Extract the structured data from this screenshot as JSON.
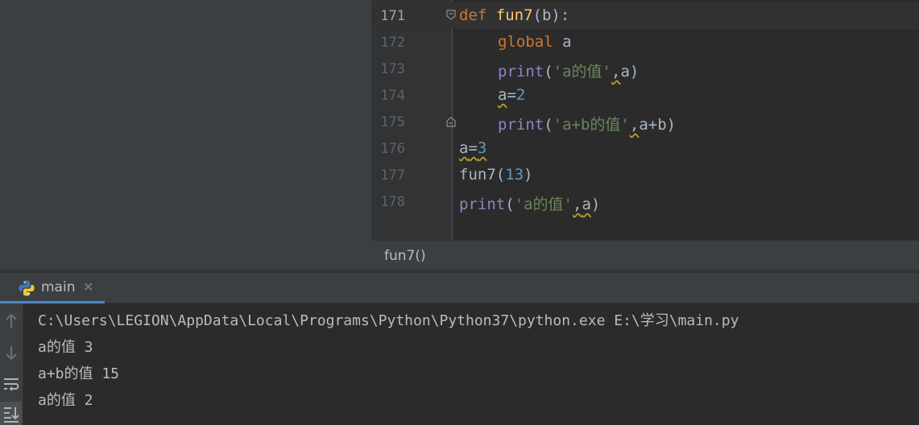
{
  "editor": {
    "lines": [
      {
        "number": "171"
      },
      {
        "number": "172"
      },
      {
        "number": "173"
      },
      {
        "number": "174"
      },
      {
        "number": "175"
      },
      {
        "number": "176"
      },
      {
        "number": "177"
      },
      {
        "number": "178"
      }
    ],
    "code": {
      "l171": {
        "kw": "def",
        "name": "fun7",
        "rest": "(b):"
      },
      "l172": {
        "kw": "global",
        "rest": "a"
      },
      "l173": {
        "call": "print",
        "open": "(",
        "str": "'a的值'",
        "comma": ",",
        "arg": "a",
        "close": ")"
      },
      "l174": {
        "var": "a",
        "op": "=",
        "num": "2"
      },
      "l175": {
        "call": "print",
        "open": "(",
        "str": "'a+b的值'",
        "comma": ",",
        "arg": "a+b",
        "close": ")"
      },
      "l176": {
        "var": "a",
        "op": "=",
        "num": "3"
      },
      "l177": {
        "name": "fun7",
        "open": "(",
        "num": "13",
        "close": ")"
      },
      "l178": {
        "call": "print",
        "open": "(",
        "str": "'a的值'",
        "comma": ",",
        "arg": "a",
        "close": ")"
      }
    },
    "breadcrumb": "fun7()"
  },
  "run_panel": {
    "tab_label": "main",
    "tab_icon": "python-icon",
    "close_icon": "close-icon",
    "toolbar_icons": [
      "arrow-up-icon",
      "arrow-down-icon",
      "soft-wrap-icon",
      "scroll-to-end-icon"
    ],
    "console_lines": [
      "C:\\Users\\LEGION\\AppData\\Local\\Programs\\Python\\Python37\\python.exe E:\\学习\\main.py",
      "a的值 3",
      "a+b的值 15",
      "a的值 2"
    ]
  },
  "colors": {
    "editor_bg": "#2b2b2b",
    "panel_bg": "#3c3f41",
    "keyword": "#cc7832",
    "function": "#ffc66d",
    "builtin": "#8888c6",
    "string": "#6a8759",
    "number": "#6897bb",
    "accent": "#4a88c7"
  }
}
